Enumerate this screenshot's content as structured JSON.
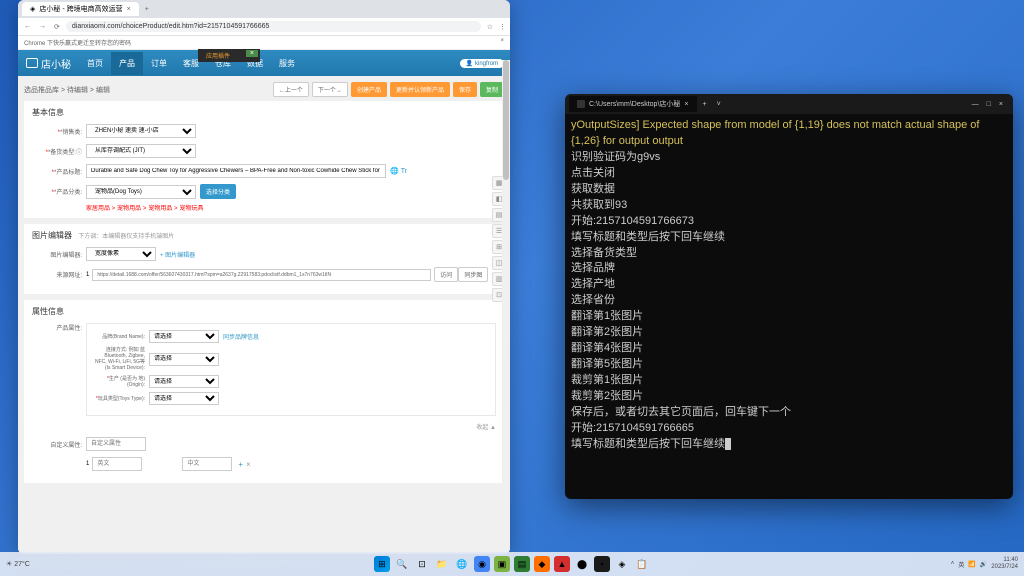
{
  "browser": {
    "tab_title": "店小秘 - 跨境电商高效运营",
    "url": "dianxiaomi.com/choiceProduct/edit.htm?id=2157104591766665",
    "info_bar": "Chrome 下快乐赢式更迁至转存您的密码",
    "app_name": "店小秘",
    "nav": [
      "首页",
      "产品",
      "订单",
      "客服",
      "仓库",
      "数据",
      "服务"
    ],
    "promo": "应用插件",
    "user": "kingfrom",
    "breadcrumb": "选品推品库 > 待编辑 > 编辑",
    "bc_btns": {
      "prev": "←上一个",
      "next": "下一个→",
      "create": "创建产品",
      "save_new": "更新并认领新产品",
      "save": "保存",
      "new": "复制"
    },
    "section1": "基本信息",
    "store_label": "*销售类:",
    "store_value": "ZHEN小秘 速卖 速-小店",
    "stock_label": "*备货类型:",
    "stock_value": "从库存调配式 (JIT)",
    "title_label": "*产品标题:",
    "title_value": "Durable and Safe Dog Chew Toy for Aggressive Chewers – BPA-Free and Non-toxic Cowhide Chew Stick for Teeth Cle",
    "cat_label": "*产品分类:",
    "cat_value": "宠物品(Dog Toys)",
    "cat_btn": "选择分类",
    "cat_path": [
      "家居用品 >",
      "宠物用品 >",
      "宠物用品 >",
      "宠物玩具"
    ],
    "section2_title": "图片编辑器",
    "section2_sub": "下方调：本编辑器仅支持手机端图片",
    "img_ratio_label": "图片编辑器:",
    "img_ratio_value": "宽度像素",
    "img_link": "+ 图片编辑器",
    "src_label": "来源网址:",
    "src_idx": "1",
    "src_url": "https://detail.1688.com/offer/563607430317.html?spm=a2637g.22917583.pdoclistf.ddbm1_1s7n763w1tIN",
    "src_btns": {
      "go": "访问",
      "sync": "同步图"
    },
    "section3": "属性信息",
    "attr_title": "产品属性:",
    "attrs": {
      "brand": {
        "label": "品牌(Brand Name):",
        "link": "同步品牌信息"
      },
      "wireless": {
        "label": "连接方式: 例如 蓝Bluetooth, Zigbee, NFC, Wi-Fi, LiFi, 5G等 (Is Smart Device):"
      },
      "origin": {
        "label": "生产 (是否为 地) (Origin):"
      },
      "type": {
        "label": "玩具类型(Toys Type):"
      }
    },
    "select_ph": "请选择",
    "section4": "自定义属性:",
    "custom_ph": "自定义属性",
    "custom_idx": "1",
    "custom_en": "英文",
    "custom_cn": "中文"
  },
  "terminal": {
    "tab": "C:\\Users\\mm\\Desktop\\店小秘",
    "lines": [
      {
        "c": "y",
        "t": "yOutputSizes] Expected shape from model of {1,19} does not match actual shape of {1,26} for output output"
      },
      {
        "c": "w",
        "t": "识别验证码为g9vs"
      },
      {
        "c": "w",
        "t": "点击关闭"
      },
      {
        "c": "w",
        "t": "获取数据"
      },
      {
        "c": "w",
        "t": "共获取到93"
      },
      {
        "c": "w",
        "t": "开始:2157104591766673"
      },
      {
        "c": "w",
        "t": "填写标题和类型后按下回车继续"
      },
      {
        "c": "w",
        "t": "选择备货类型"
      },
      {
        "c": "w",
        "t": "选择品牌"
      },
      {
        "c": "w",
        "t": "选择产地"
      },
      {
        "c": "w",
        "t": "选择省份"
      },
      {
        "c": "w",
        "t": "翻译第1张图片"
      },
      {
        "c": "w",
        "t": "翻译第2张图片"
      },
      {
        "c": "w",
        "t": "翻译第4张图片"
      },
      {
        "c": "w",
        "t": "翻译第5张图片"
      },
      {
        "c": "w",
        "t": "裁剪第1张图片"
      },
      {
        "c": "w",
        "t": "裁剪第2张图片"
      },
      {
        "c": "w",
        "t": "保存后，或者切去其它页面后，回车键下一个"
      },
      {
        "c": "w",
        "t": "开始:2157104591766665"
      },
      {
        "c": "w",
        "t": "填写标题和类型后按下回车继续"
      }
    ]
  },
  "taskbar": {
    "time": "11:40",
    "date": "2023/7/24"
  }
}
